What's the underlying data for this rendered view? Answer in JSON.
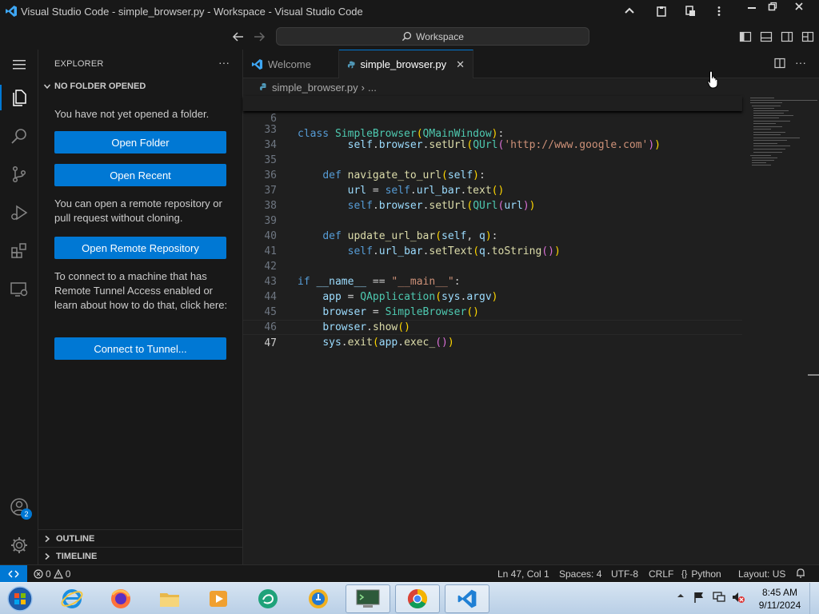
{
  "window": {
    "title": "Visual Studio Code - simple_browser.py - Workspace - Visual Studio Code"
  },
  "command_center": {
    "search_label": "Workspace"
  },
  "activity_bar": {
    "account_badge": "2"
  },
  "sidebar": {
    "title": "EXPLORER",
    "section": "NO FOLDER OPENED",
    "no_folder_text": "You have not yet opened a folder.",
    "open_folder": "Open Folder",
    "open_recent": "Open Recent",
    "remote_text": "You can open a remote repository or pull request without cloning.",
    "open_remote": "Open Remote Repository",
    "tunnel_text": "To connect to a machine that has Remote Tunnel Access enabled or learn about how to do that, click here:",
    "connect_tunnel": "Connect to Tunnel...",
    "outline": "OUTLINE",
    "timeline": "TIMELINE"
  },
  "tabs": [
    {
      "label": "Welcome"
    },
    {
      "label": "simple_browser.py"
    }
  ],
  "breadcrumb": {
    "file": "simple_browser.py",
    "rest": "..."
  },
  "code": {
    "sticky_line_number": "6",
    "lines": [
      {
        "n": "33"
      },
      {
        "n": "34"
      },
      {
        "n": "35"
      },
      {
        "n": "36"
      },
      {
        "n": "37"
      },
      {
        "n": "38"
      },
      {
        "n": "39"
      },
      {
        "n": "40"
      },
      {
        "n": "41"
      },
      {
        "n": "42"
      },
      {
        "n": "43"
      },
      {
        "n": "44"
      },
      {
        "n": "45"
      },
      {
        "n": "46"
      },
      {
        "n": "47"
      }
    ]
  },
  "status_bar": {
    "errors": "0",
    "warnings": "0",
    "position": "Ln 47, Col 1",
    "spaces": "Spaces: 4",
    "encoding": "UTF-8",
    "eol": "CRLF",
    "language": "Python",
    "layout": "Layout: US"
  },
  "taskbar": {
    "time": "8:45 AM",
    "date": "9/11/2024"
  },
  "colors": {
    "accent": "#0078d4",
    "keyword": "#569cd6",
    "class": "#4ec9b0",
    "function": "#dcdcaa",
    "string": "#ce9178"
  }
}
